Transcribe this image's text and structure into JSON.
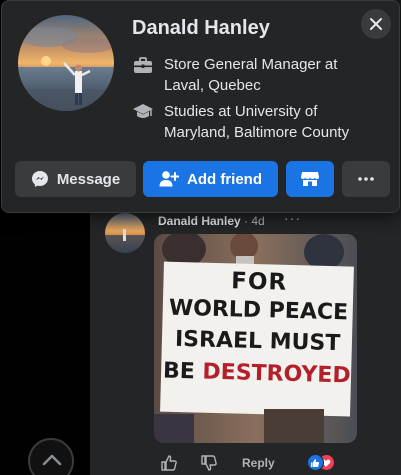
{
  "profile_card": {
    "name": "Danald Hanley",
    "work": "Store General Manager at Laval, Quebec",
    "education": "Studies at University of Maryland, Baltimore County",
    "buttons": {
      "message": "Message",
      "add_friend": "Add friend"
    }
  },
  "comment": {
    "author": "Danald Hanley",
    "time": " · 4d",
    "more": "···",
    "image_sign_lines": [
      "FOR",
      "WORLD PEACE",
      "ISRAEL MUST",
      "BE",
      "DESTROYED"
    ],
    "reply_label": "Reply"
  },
  "colors": {
    "accent": "#1b74e4",
    "background": "#242526",
    "love": "#f33e58"
  }
}
